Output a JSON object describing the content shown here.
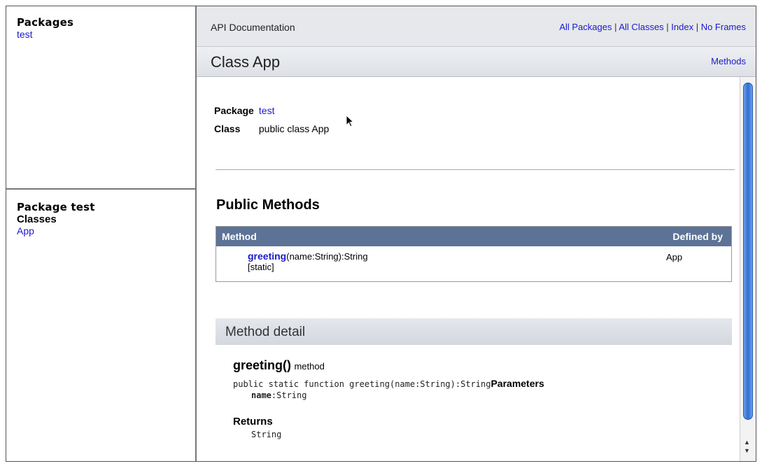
{
  "left_top": {
    "heading": "Packages",
    "packages": [
      "test"
    ]
  },
  "left_bottom": {
    "heading": "Package test",
    "classes_label": "Classes",
    "classes": [
      "App"
    ]
  },
  "topbar": {
    "title": "API Documentation",
    "links": [
      "All Packages",
      "All Classes",
      "Index",
      "No Frames"
    ]
  },
  "titlebar": {
    "title": "Class App",
    "methods_link": "Methods"
  },
  "summary": {
    "package_label": "Package",
    "package_value": "test",
    "class_label": "Class",
    "class_value": "public class App"
  },
  "public_methods": {
    "heading": "Public Methods",
    "col_method": "Method",
    "col_defined": "Defined by",
    "rows": [
      {
        "name": "greeting",
        "signature": "(name:String):String",
        "modifier": "[static]",
        "defined_by": "App"
      }
    ]
  },
  "method_detail": {
    "heading": "Method detail",
    "name": "greeting()",
    "kind": "method",
    "signature": "public static function greeting(name:String):String",
    "params_label": "Parameters",
    "param_name": "name",
    "param_type": ":String",
    "returns_label": "Returns",
    "returns_type": "String"
  }
}
